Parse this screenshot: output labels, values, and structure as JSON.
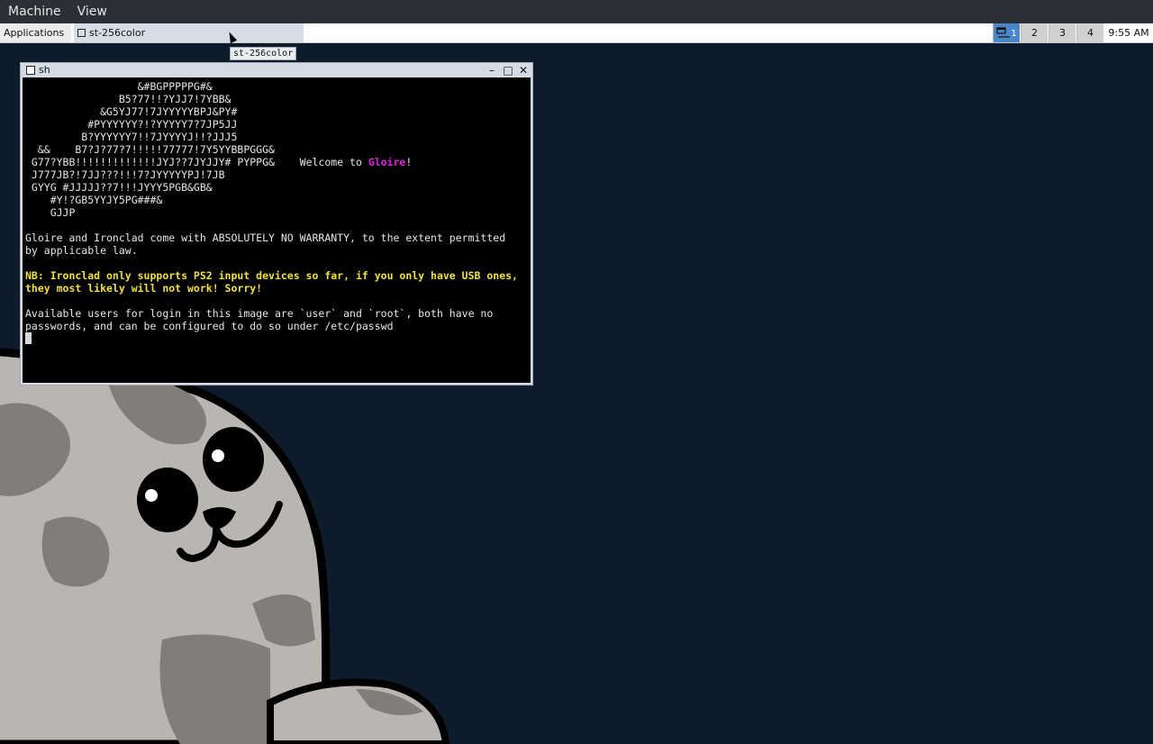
{
  "host_menu": {
    "items": [
      "Machine",
      "View"
    ]
  },
  "panel": {
    "applications_label": "Applications",
    "task_label": "st-256color",
    "workspaces": [
      "1",
      "2",
      "3",
      "4"
    ],
    "active_workspace": "1",
    "clock": "9:55 AM"
  },
  "tooltip": {
    "text": "st-256color"
  },
  "window": {
    "title": "sh",
    "minimize_glyph": "–",
    "maximize_glyph": "□",
    "close_glyph": "✕"
  },
  "terminal": {
    "logo_lines": [
      "                  &#BGPPPPPG#&",
      "               B5?77!!?YJJ7!7YBB&",
      "            &G5YJ77!7JYYYYYBPJ&PY#",
      "          #PYYYYYY?!?YYYYY7?7JP5JJ",
      "         B?YYYYYY7!!7JYYYYJ!!?JJJ5",
      "  &&    B7?J?77?7!!!!!77777!7Y5YYBBPGGG&",
      " G77?YBB!!!!!!!!!!!!!JYJ??7JYJJY# PYPPG&",
      " J777JB?!7JJ???!!!7?JYYYYYPJ!7JB",
      " GYYG #JJJJJ??7!!!JYYY5PGB&GB&",
      "    #Y!?GB5YYJY5PG###&",
      "    GJJP"
    ],
    "welcome_prefix": "    Welcome to ",
    "welcome_name": "Gloire",
    "welcome_suffix": "!",
    "warranty_1": "Gloire and Ironclad come with ABSOLUTELY NO WARRANTY, to the extent permitted",
    "warranty_2": "by applicable law.",
    "nb_1": "NB: Ironclad only supports PS2 input devices so far, if you only have USB ones,",
    "nb_2": "they most likely will not work! Sorry!",
    "users_1": "Available users for login in this image are `user` and `root`, both have no",
    "users_2": "passwords, and can be configured to do so under /etc/passwd"
  },
  "colors": {
    "desktop": "#0d1b2a",
    "accent_magenta": "#e020e0",
    "notice_yellow": "#f0e040",
    "active_workspace": "#4a86c8"
  },
  "wallpaper": {
    "icon": "seal-mascot"
  }
}
